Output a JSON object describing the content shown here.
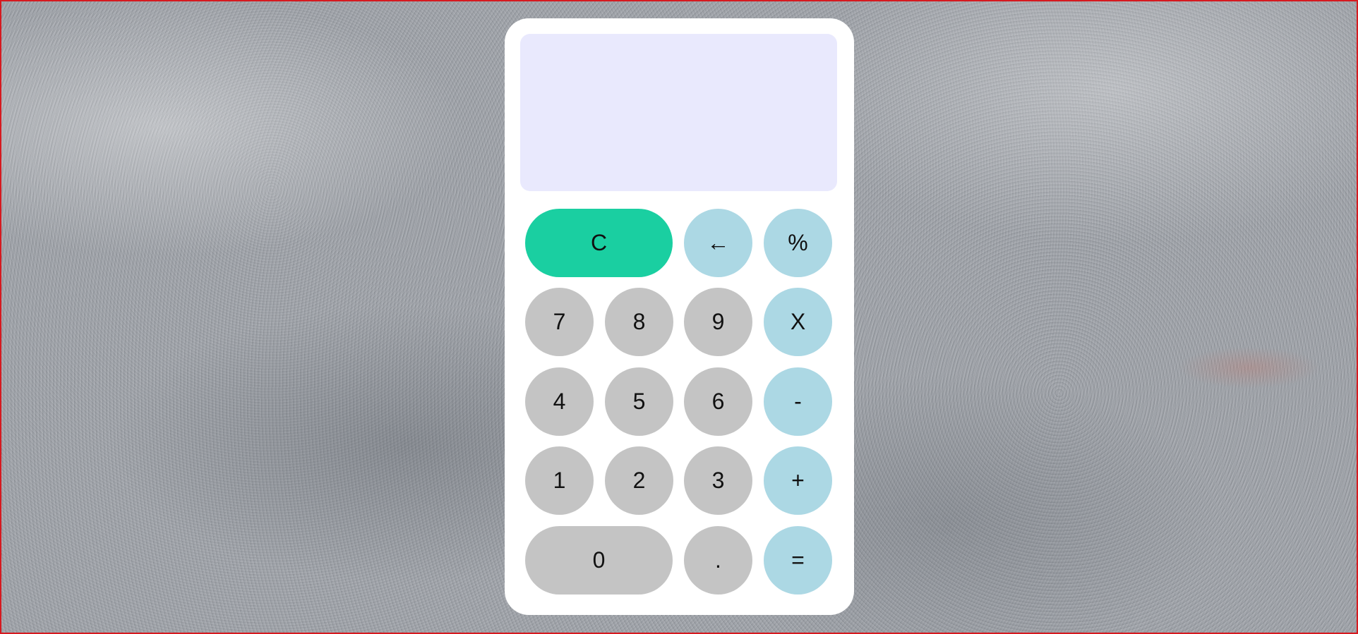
{
  "display": {
    "value": ""
  },
  "colors": {
    "number_key": "#c4c4c4",
    "operator_key": "#acd8e4",
    "clear_key": "#1acfa1",
    "display_bg": "#e9e9fd",
    "frame_border": "#d6191f"
  },
  "keys": {
    "clear": "C",
    "backspace": "←",
    "percent": "%",
    "seven": "7",
    "eight": "8",
    "nine": "9",
    "multiply": "X",
    "four": "4",
    "five": "5",
    "six": "6",
    "minus": "-",
    "one": "1",
    "two": "2",
    "three": "3",
    "plus": "+",
    "zero": "0",
    "decimal": ".",
    "equals": "="
  },
  "icons": {
    "backspace": "backspace-arrow-icon"
  }
}
